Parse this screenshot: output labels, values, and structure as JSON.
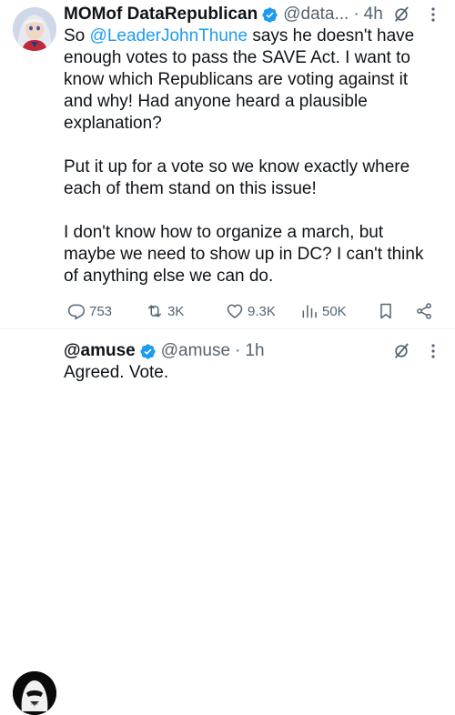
{
  "tweet": {
    "author_name": "MOMof DataRepublican",
    "author_handle": "@data...",
    "separator": "·",
    "time": "4h",
    "body_prefix": "So ",
    "mention": "@LeaderJohnThune",
    "body_line_1_rest": " says he doesn't have enough votes to pass the SAVE Act. I want to know which Republicans are voting against it and why! Had anyone heard a plausible explanation?",
    "paragraph_2": "Put it up for a vote so we know exactly where each of them stand on this issue!",
    "paragraph_3": "I don't know how to organize a march, but maybe we need to show up in DC? I can't think of anything else we can do.",
    "stats": {
      "replies": "753",
      "reposts": "3K",
      "likes": "9.3K",
      "views": "50K"
    }
  },
  "reply": {
    "author_name": "@amuse",
    "author_handle": "@amuse",
    "separator": "·",
    "time": "1h",
    "body": "Agreed. Vote."
  },
  "colors": {
    "text": "#0f1419",
    "secondary": "#536471",
    "accent": "#1d9bf0"
  },
  "icons": {
    "verified": "verified-badge-icon",
    "grok": "grok-icon",
    "more": "more-icon",
    "reply": "reply-icon",
    "repost": "repost-icon",
    "like": "like-icon",
    "views": "views-icon",
    "bookmark": "bookmark-icon",
    "share": "share-icon"
  }
}
